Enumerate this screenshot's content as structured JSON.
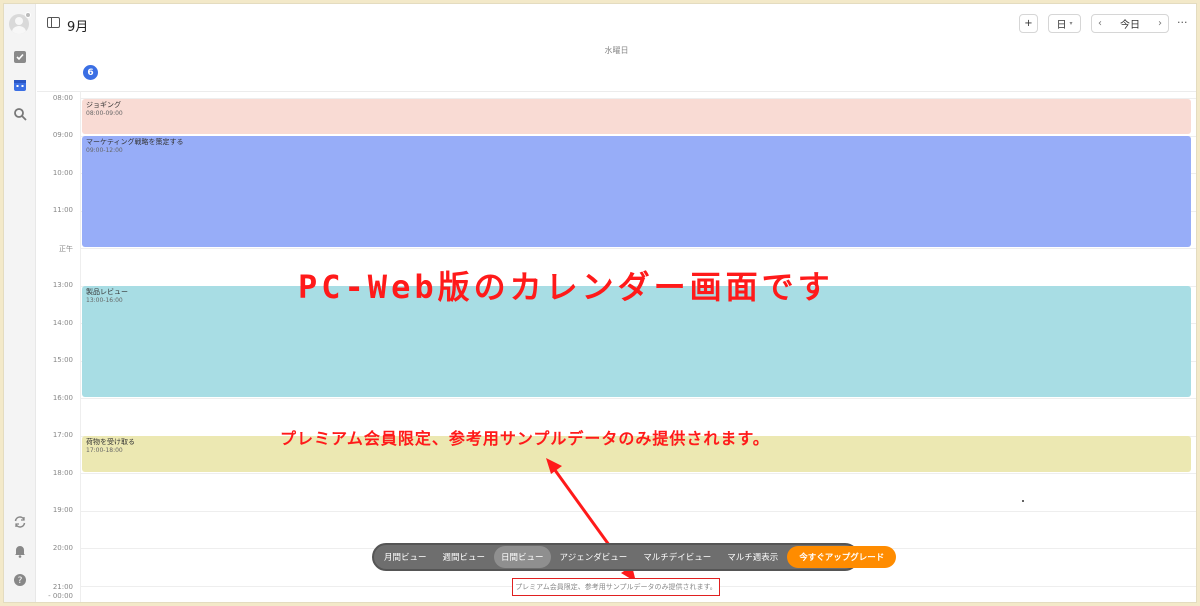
{
  "header": {
    "month_title": "9月",
    "add_label": "+",
    "view_select": "日",
    "today_label": "今日",
    "more_label": "···"
  },
  "day": {
    "weekday": "水曜日",
    "date": "6"
  },
  "time_labels": [
    "08:00",
    "09:00",
    "10:00",
    "11:00",
    "正午",
    "13:00",
    "14:00",
    "15:00",
    "16:00",
    "17:00",
    "18:00",
    "19:00",
    "20:00",
    "21:00\n- 00:00"
  ],
  "events": [
    {
      "title": "ジョギング",
      "time": "08:00-09:00",
      "color": "#f9dbd4"
    },
    {
      "title": "マーケティング戦略を策定する",
      "time": "09:00-12:00",
      "color": "#97adf8"
    },
    {
      "title": "製品レビュー",
      "time": "13:00-16:00",
      "color": "#a8dde4"
    },
    {
      "title": "荷物を受け取る",
      "time": "17:00-18:00",
      "color": "#ece8b2"
    }
  ],
  "annotations": {
    "big": "PC-Web版のカレンダー画面です",
    "mid": "プレミアム会員限定、参考用サンプルデータのみ提供されます。",
    "box": "プレミアム会員限定、参考用サンプルデータのみ提供されます。"
  },
  "view_bar": {
    "items": [
      "月間ビュー",
      "週間ビュー",
      "日間ビュー",
      "アジェンダビュー",
      "マルチデイビュー",
      "マルチ週表示"
    ],
    "active_index": 2,
    "upgrade": "今すぐアップグレード"
  },
  "colors": {
    "accent": "#3b6fe4",
    "upgrade": "#ff8c00",
    "annotation": "#ff1a1a"
  }
}
